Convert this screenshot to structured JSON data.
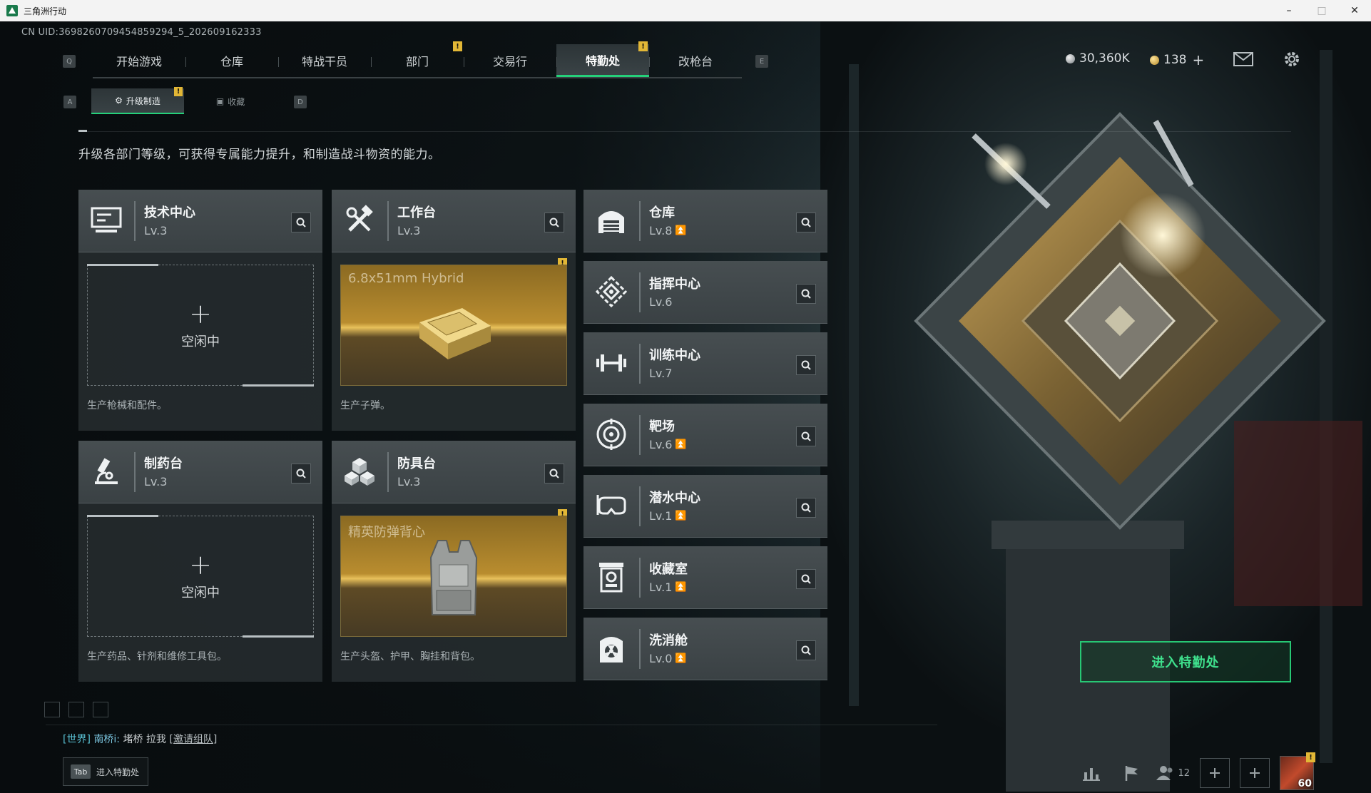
{
  "window": {
    "title": "三角洲行动",
    "minimize": "–",
    "maximize": "□",
    "close": "✕"
  },
  "uid": "CN UID:3698260709454859294_5_202609162333",
  "nav": {
    "key_left": "Q",
    "key_right": "E",
    "tabs": [
      {
        "label": "开始游戏",
        "active": false,
        "alert": false
      },
      {
        "label": "仓库",
        "active": false,
        "alert": false
      },
      {
        "label": "特战干员",
        "active": false,
        "alert": false
      },
      {
        "label": "部门",
        "active": false,
        "alert": true
      },
      {
        "label": "交易行",
        "active": false,
        "alert": false
      },
      {
        "label": "特勤处",
        "active": true,
        "alert": true
      },
      {
        "label": "改枪台",
        "active": false,
        "alert": false
      }
    ]
  },
  "currency": {
    "silver": "30,360K",
    "gold": "138",
    "add": "+"
  },
  "subtabs": {
    "key_left": "A",
    "key_right": "D",
    "items": [
      {
        "label": "升级制造",
        "active": true
      },
      {
        "label": "收藏",
        "active": false
      }
    ]
  },
  "description": "升级各部门等级，可获得专属能力提升，和制造战斗物资的能力。",
  "alert_symbol": "!",
  "idle_plus": "+",
  "production_cards": [
    {
      "name": "技术中心",
      "level": "Lv.3",
      "icon": "monitor-icon",
      "slot": {
        "state": "idle",
        "text": "空闲中"
      },
      "note": "生产枪械和配件。"
    },
    {
      "name": "工作台",
      "level": "Lv.3",
      "icon": "tools-icon",
      "slot": {
        "state": "item",
        "text": "6.8x51mm Hybrid"
      },
      "note": "生产子弹。"
    },
    {
      "name": "制药台",
      "level": "Lv.3",
      "icon": "microscope-icon",
      "slot": {
        "state": "idle",
        "text": "空闲中"
      },
      "note": "生产药品、针剂和维修工具包。"
    },
    {
      "name": "防具台",
      "level": "Lv.3",
      "icon": "cubes-icon",
      "slot": {
        "state": "item",
        "text": "精英防弹背心"
      },
      "note": "生产头盔、护甲、胸挂和背包。"
    }
  ],
  "facilities": [
    {
      "name": "仓库",
      "level": "Lv.8",
      "upgradable": true,
      "icon": "warehouse-icon"
    },
    {
      "name": "指挥中心",
      "level": "Lv.6",
      "upgradable": false,
      "icon": "command-icon"
    },
    {
      "name": "训练中心",
      "level": "Lv.7",
      "upgradable": false,
      "icon": "dumbbell-icon"
    },
    {
      "name": "靶场",
      "level": "Lv.6",
      "upgradable": true,
      "icon": "target-icon"
    },
    {
      "name": "潜水中心",
      "level": "Lv.1",
      "upgradable": true,
      "icon": "diving-mask-icon"
    },
    {
      "name": "收藏室",
      "level": "Lv.1",
      "upgradable": true,
      "icon": "collection-icon"
    },
    {
      "name": "洗消舱",
      "level": "Lv.0",
      "upgradable": true,
      "icon": "decontamination-icon"
    }
  ],
  "enter_button": "进入特勤处",
  "chat": {
    "channel": "[世界]",
    "sender": "南桥i:",
    "message": "堵桥 拉我",
    "link": "[邀请组队]"
  },
  "tab_hint": {
    "key": "Tab",
    "label": "进入特勤处"
  },
  "footer": {
    "friends_count": "12",
    "player_level": "60"
  },
  "colors": {
    "accent_green": "#25d07a",
    "alert_yellow": "#e2b736",
    "panel": "#3a4144"
  }
}
